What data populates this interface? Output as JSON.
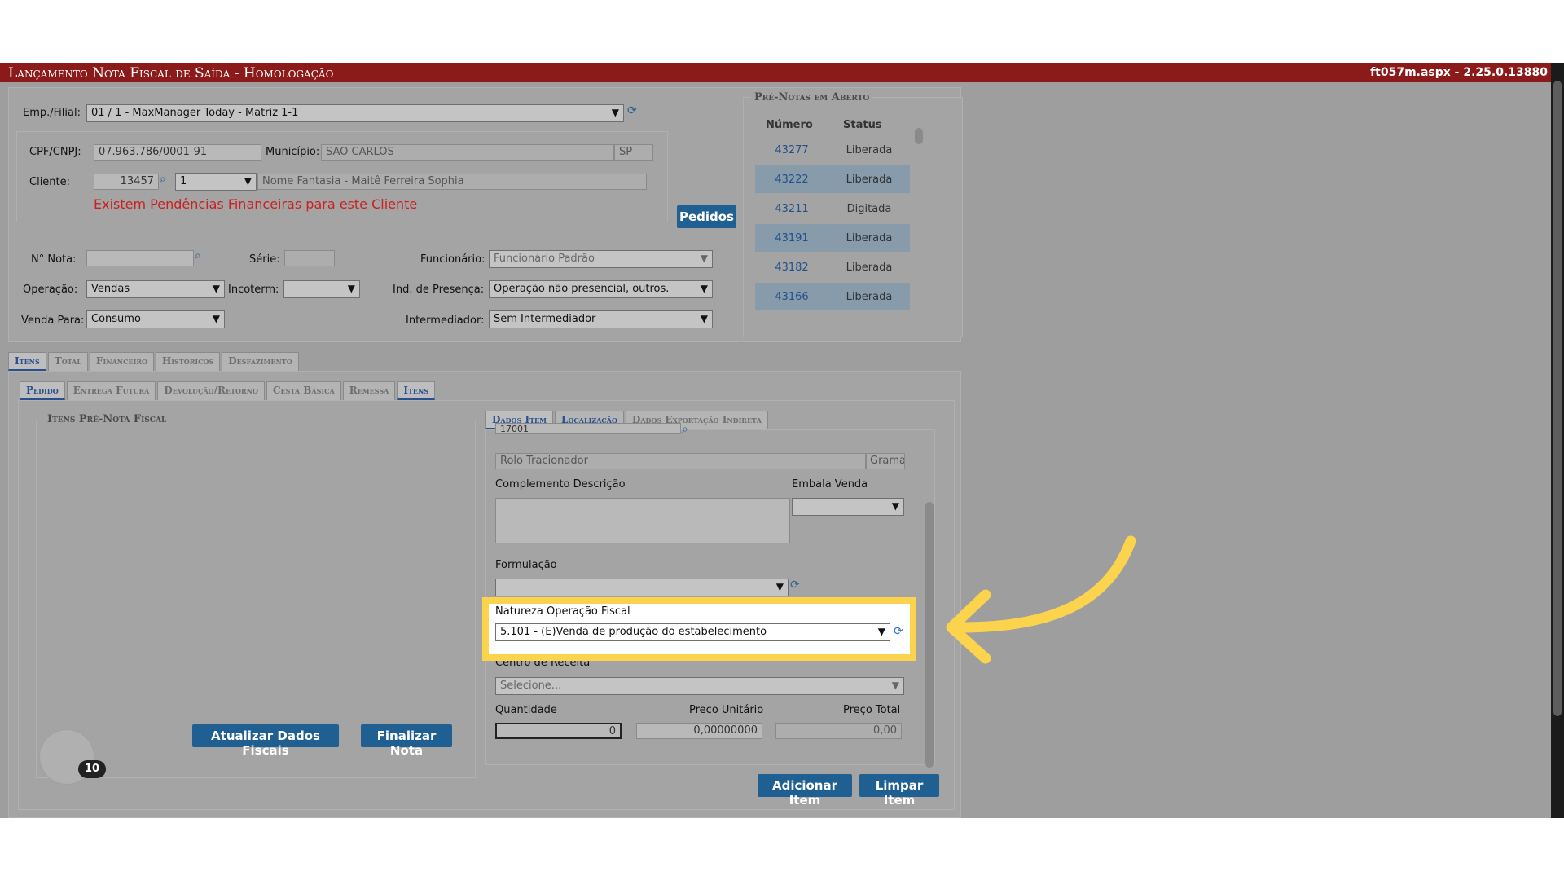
{
  "window": {
    "title": "Lançamento Nota Fiscal de Saída  - Homologação",
    "version": "ft057m.aspx - 2.25.0.13880"
  },
  "header_form": {
    "emp_filial_label": "Emp./Filial:",
    "emp_filial_value": "01 / 1 - MaxManager Today - Matriz 1-1",
    "cpf_cnpj_label": "CPF/CNPJ:",
    "cpf_cnpj_value": "07.963.786/0001-91",
    "municipio_label": "Município:",
    "municipio_value": "SAO CARLOS",
    "uf_value": "SP",
    "cliente_label": "Cliente:",
    "cliente_code": "13457",
    "cliente_select": "1",
    "cliente_name": "Nome Fantasia - Maitê Ferreira Sophia",
    "pendencia_msg": "Existem Pendências Financeiras para este Cliente",
    "pedidos_button": "Pedidos",
    "nota_label": "N° Nota:",
    "serie_label": "Série:",
    "funcionario_label": "Funcionário:",
    "funcionario_value": "Funcionário Padrão",
    "operacao_label": "Operação:",
    "operacao_value": "Vendas",
    "incoterm_label": "Incoterm:",
    "ind_presenca_label": "Ind. de Presença:",
    "ind_presenca_value": "Operação não presencial, outros.",
    "venda_para_label": "Venda Para:",
    "venda_para_value": "Consumo",
    "intermediador_label": "Intermediador:",
    "intermediador_value": "Sem Intermediador"
  },
  "pre_notas": {
    "title": "Pré-Notas em Aberto",
    "col_numero": "Número",
    "col_status": "Status",
    "rows": [
      {
        "numero": "43277",
        "status": "Liberada"
      },
      {
        "numero": "43222",
        "status": "Liberada"
      },
      {
        "numero": "43211",
        "status": "Digitada"
      },
      {
        "numero": "43191",
        "status": "Liberada"
      },
      {
        "numero": "43182",
        "status": "Liberada"
      },
      {
        "numero": "43166",
        "status": "Liberada"
      }
    ]
  },
  "main_tabs": [
    "Itens",
    "Total",
    "Financeiro",
    "Históricos",
    "Desfazimento"
  ],
  "sub_tabs": [
    "Pedido",
    "Entrega Futura",
    "Devolução/Retorno",
    "Cesta Básica",
    "Remessa",
    "Itens"
  ],
  "itens_pre_nota_title": "Itens Pré-Nota Fiscal",
  "item_tabs": [
    "Dados Item",
    "Localização",
    "Dados Exportação Indireta"
  ],
  "item_form": {
    "product_code": "17001",
    "product_desc": "Rolo Tracionador",
    "unit": "Grama",
    "complemento_label": "Complemento Descrição",
    "embala_label": "Embala Venda",
    "formulacao_label": "Formulação",
    "natureza_label": "Natureza Operação Fiscal",
    "natureza_value": "5.101 - (E)Venda de produção do estabelecimento",
    "centro_label": "Centro de Receita",
    "centro_placeholder": "Selecione...",
    "quantidade_label": "Quantidade",
    "quantidade_value": "0",
    "preco_unit_label": "Preço Unitário",
    "preco_unit_value": "0,00000000",
    "preco_total_label": "Preço Total",
    "preco_total_value": "0,00"
  },
  "buttons": {
    "atualizar": "Atualizar Dados Fiscais",
    "finalizar": "Finalizar Nota",
    "adicionar": "Adicionar Item",
    "limpar": "Limpar Item"
  },
  "badge_count": "10",
  "colors": {
    "titlebar": "#8b1a1a",
    "button": "#1f5f92",
    "highlight": "#fcd34d",
    "error_text": "#cc1f1f"
  }
}
